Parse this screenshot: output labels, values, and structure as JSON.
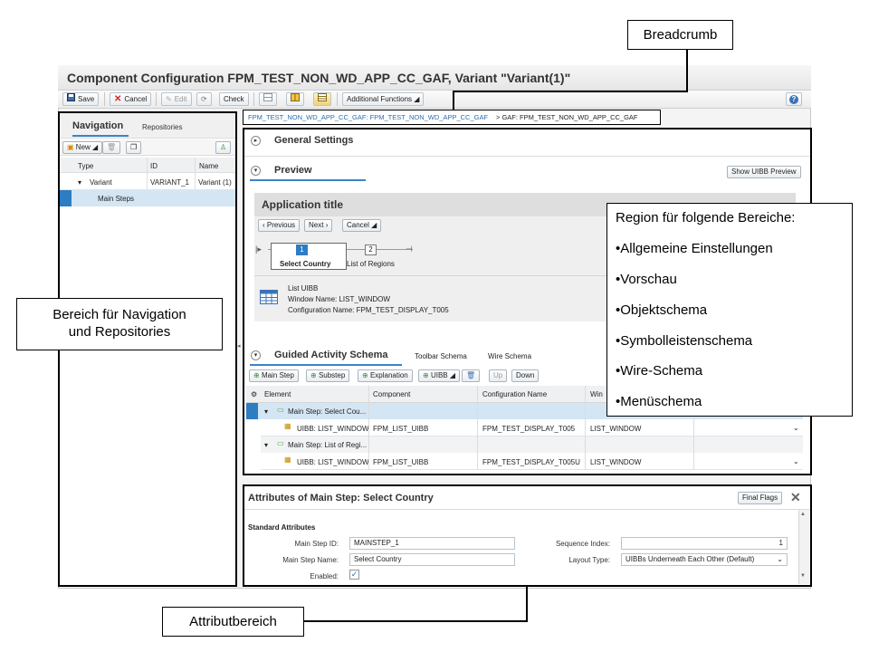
{
  "app": {
    "title": "Component Configuration FPM_TEST_NON_WD_APP_CC_GAF, Variant \"Variant(1)\"",
    "help_icon": "help-icon"
  },
  "toolbar": {
    "save": "Save",
    "cancel": "Cancel",
    "edit": "Edit",
    "check": "Check",
    "additional_functions": "Additional Functions"
  },
  "nav": {
    "tab_navigation": "Navigation",
    "tab_repositories": "Repositories",
    "new_label": "New",
    "columns": [
      "Type",
      "ID",
      "Name"
    ],
    "rows": [
      {
        "type": "Variant",
        "id": "VARIANT_1",
        "name": "Variant (1)"
      },
      {
        "type": "Main Steps",
        "id": "",
        "name": ""
      }
    ]
  },
  "breadcrumb": {
    "link": "FPM_TEST_NON_WD_APP_CC_GAF: FPM_TEST_NON_WD_APP_CC_GAF",
    "current": "> GAF: FPM_TEST_NON_WD_APP_CC_GAF"
  },
  "main": {
    "general_settings": "General Settings",
    "preview": "Preview",
    "show_uibb_preview": "Show UIBB Preview",
    "app_title": "Application title",
    "previous": "Previous",
    "next": "Next",
    "cancel": "Cancel",
    "step1_num": "1",
    "step1_label": "Select Country",
    "step2_num": "2",
    "step2_label": "List of Regions",
    "uibb_title": "List UIBB",
    "uibb_window": "Window Name: LIST_WINDOW",
    "uibb_config": "Configuration Name: FPM_TEST_DISPLAY_T005",
    "tab_guided": "Guided Activity Schema",
    "tab_toolbar": "Toolbar Schema",
    "tab_wire": "Wire Schema",
    "btn_main_step": "Main Step",
    "btn_substep": "Substep",
    "btn_explanation": "Explanation",
    "btn_uibb": "UIBB",
    "btn_up": "Up",
    "btn_down": "Down",
    "columns": [
      "Element",
      "Component",
      "Configuration Name",
      "Win"
    ],
    "rows": [
      {
        "element": "Main Step: Select Cou...",
        "component": "",
        "config": "",
        "window": ""
      },
      {
        "element": "UIBB: LIST_WINDOW",
        "component": "FPM_LIST_UIBB",
        "config": "FPM_TEST_DISPLAY_T005",
        "window": "LIST_WINDOW"
      },
      {
        "element": "Main Step: List of Regi...",
        "component": "",
        "config": "",
        "window": ""
      },
      {
        "element": "UIBB: LIST_WINDOW",
        "component": "FPM_LIST_UIBB",
        "config": "FPM_TEST_DISPLAY_T005U",
        "window": "LIST_WINDOW"
      }
    ]
  },
  "attrs": {
    "title": "Attributes of Main Step: Select Country",
    "final_flags": "Final Flags",
    "section": "Standard Attributes",
    "main_step_id_label": "Main Step ID:",
    "main_step_id": "MAINSTEP_1",
    "main_step_name_label": "Main Step Name:",
    "main_step_name": "Select Country",
    "enabled_label": "Enabled:",
    "sequence_index_label": "Sequence Index:",
    "sequence_index": "1",
    "layout_type_label": "Layout Type:",
    "layout_type": "UIBBs Underneath Each Other (Default)"
  },
  "callouts": {
    "breadcrumb": "Breadcrumb",
    "nav_line1": "Bereich für Navigation",
    "nav_line2": "und Repositories",
    "region_title": "Region für folgende Bereiche:",
    "region_items": [
      "•Allgemeine Einstellungen",
      "•Vorschau",
      "•Objektschema",
      "•Symbolleistenschema",
      "•Wire-Schema",
      "•Menüschema"
    ],
    "attr": "Attributbereich"
  }
}
